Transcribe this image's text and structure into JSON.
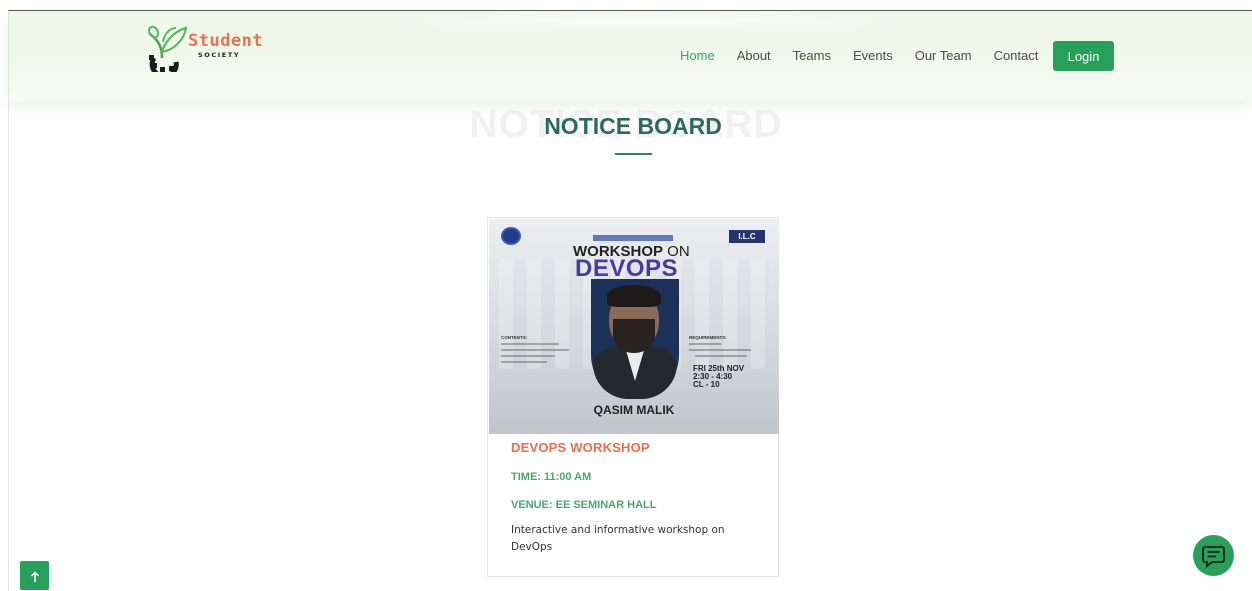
{
  "brand": {
    "title": "Student",
    "subtitle": "SOCIETY"
  },
  "nav": {
    "items": [
      {
        "label": "Home",
        "active": true
      },
      {
        "label": "About",
        "active": false
      },
      {
        "label": "Teams",
        "active": false
      },
      {
        "label": "Events",
        "active": false
      },
      {
        "label": "Our Team",
        "active": false
      },
      {
        "label": "Contact",
        "active": false
      }
    ],
    "login_label": "Login"
  },
  "section": {
    "background_title": "NOTICE BOARD",
    "title": "NOTICE BOARD"
  },
  "notice": {
    "poster": {
      "heading_main": "WORKSHOP",
      "heading_on": "ON",
      "heading_topic": "DEVOPS",
      "badge": "I.L.C",
      "contents_head": "CONTENTS:",
      "requirements_head": "REQUIREMENTS:",
      "date_line1": "FRI 25th NOV",
      "date_line2": "2:30 - 4:30",
      "date_line3": "CL - 10",
      "speaker": "QASIM MALIK"
    },
    "title": "DEVOPS WORKSHOP",
    "time": "TIME: 11:00 AM",
    "venue": "VENUE: EE SEMINAR HALL",
    "description": "Interactive and informative workshop on DevOps"
  },
  "colors": {
    "accent_green": "#27a05a",
    "title_teal": "#2b6a5d",
    "event_orange": "#ee6b4c",
    "info_green": "#4da56d"
  },
  "icons": {
    "scroll_top": "arrow-up-icon",
    "chat": "chat-icon",
    "logo": "leaf-gear-icon"
  }
}
